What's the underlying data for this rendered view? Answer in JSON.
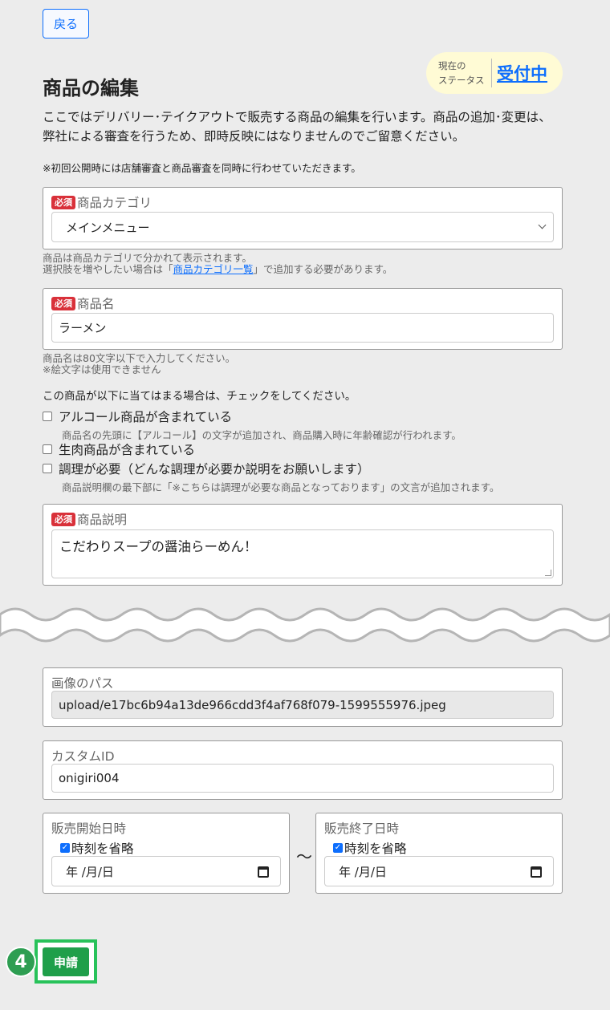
{
  "header": {
    "back_label": "戻る",
    "status_label": "現在の\nステータス",
    "status_value": "受付中",
    "title": "商品の編集"
  },
  "intro": {
    "text": "ここではデリバリー･テイクアウトで販売する商品の編集を行います。商品の追加･変更は、弊社による審査を行うため、即時反映にはなりませんのでご留意ください。",
    "note": "※初回公開時には店舗審査と商品審査を同時に行わせていただきます。"
  },
  "category": {
    "required": "必須",
    "label": "商品カテゴリ",
    "value": "メインメニュー",
    "help_line1": "商品は商品カテゴリで分かれて表示されます。",
    "help_line2_before": "選択肢を増やしたい場合は「",
    "help_link": "商品カテゴリ一覧",
    "help_line2_after": "」で追加する必要があります。"
  },
  "product_name": {
    "required": "必須",
    "label": "商品名",
    "value": "ラーメン",
    "help_line1": "商品名は80文字以下で入力してください。",
    "help_line2": "※絵文字は使用できません"
  },
  "checks": {
    "intro": "この商品が以下に当てはまる場合は、チェックをしてください。",
    "alcohol": "アルコール商品が含まれている",
    "alcohol_note": "商品名の先頭に【アルコール】の文字が追加され、商品購入時に年齢確認が行われます。",
    "raw_meat": "生肉商品が含まれている",
    "cooking": "調理が必要（どんな調理が必要か説明をお願いします）",
    "cooking_note": "商品説明欄の最下部に「※こちらは調理が必要な商品となっております」の文言が追加されます。"
  },
  "description": {
    "required": "必須",
    "label": "商品説明",
    "value": "こだわりスープの醤油らーめん！"
  },
  "image_path": {
    "label": "画像のパス",
    "value": "upload/e17bc6b94a13de966cdd3f4af768f079-1599555976.jpeg"
  },
  "custom_id": {
    "label": "カスタムID",
    "value": "onigiri004"
  },
  "sale_start": {
    "label": "販売開始日時",
    "omit_time": "時刻を省略",
    "placeholder": "年 /月/日"
  },
  "sale_end": {
    "label": "販売終了日時",
    "omit_time": "時刻を省略",
    "placeholder": "年 /月/日"
  },
  "range_separator": "～",
  "step": {
    "number": "4",
    "submit_label": "申請"
  },
  "colors": {
    "accent": "#0d6efd",
    "required": "#d9313a",
    "submit": "#1f9f4a",
    "status_bg": "#fffbd5"
  }
}
